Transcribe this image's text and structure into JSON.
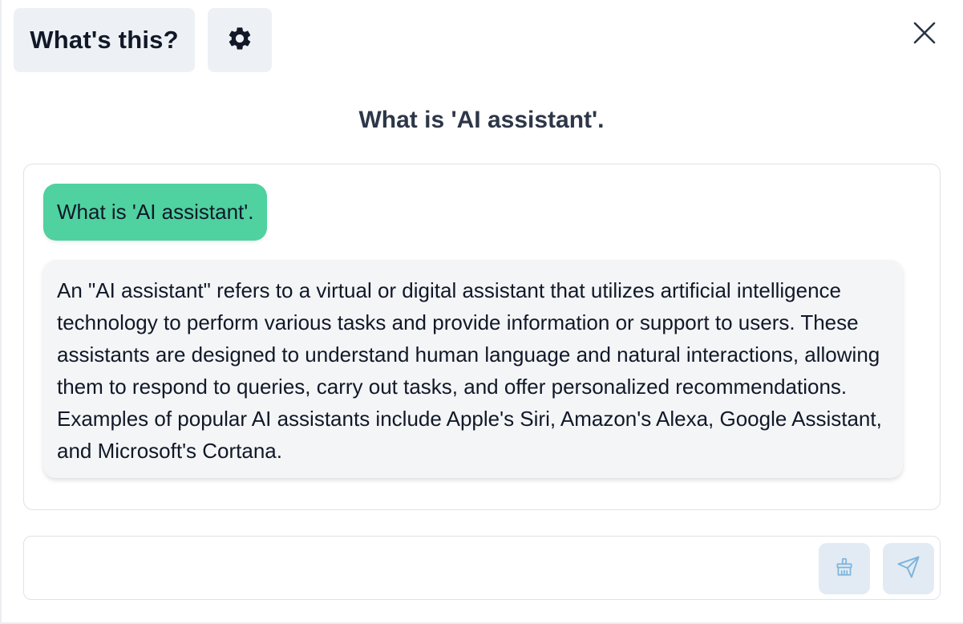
{
  "header": {
    "whats_this_label": "What's this?",
    "settings_icon": "gear-icon",
    "close_icon": "close-icon"
  },
  "title": "What is 'AI assistant'.",
  "chat": {
    "messages": [
      {
        "role": "user",
        "text": "What is 'AI assistant'."
      },
      {
        "role": "assistant",
        "text": "An \"AI assistant\" refers to a virtual or digital assistant that utilizes artificial intelligence technology to perform various tasks and provide information or support to users. These assistants are designed to understand human language and natural interactions, allowing them to respond to queries, carry out tasks, and offer personalized recommendations. Examples of popular AI assistants include Apple's Siri, Amazon's Alexa, Google Assistant, and Microsoft's Cortana."
      }
    ]
  },
  "composer": {
    "value": "",
    "placeholder": "",
    "clear_icon": "broom-icon",
    "send_icon": "send-icon"
  },
  "colors": {
    "user_bubble": "#4fd1a0",
    "assistant_bubble": "#f4f5f7",
    "header_button": "#edf1f5",
    "tool_button": "#e2ebf3",
    "tool_icon": "#7fb4dc",
    "title_text": "#2d3748"
  }
}
